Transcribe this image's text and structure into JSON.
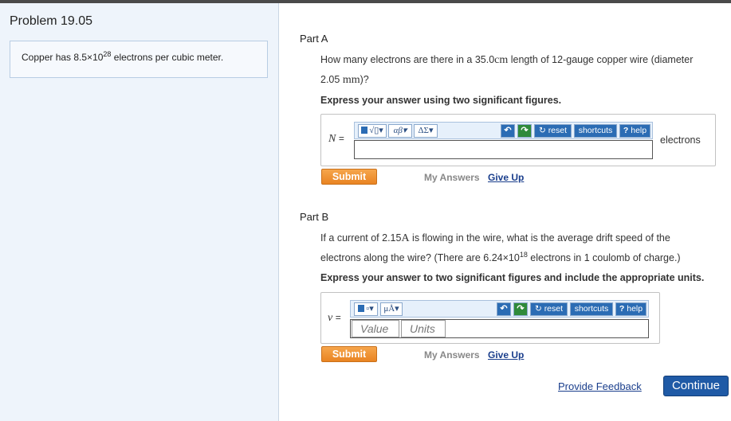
{
  "problem": {
    "title": "Problem 19.05",
    "statement_prefix": "Copper has 8.5×10",
    "statement_exp": "28",
    "statement_suffix": " electrons per cubic meter."
  },
  "partA": {
    "title": "Part A",
    "question_1": "How many electrons are there in a 35.0",
    "question_unit1": "cm",
    "question_2": " length of 12-gauge copper wire (diameter",
    "question_3": "2.05 ",
    "question_unit2": "mm",
    "question_4": ")?",
    "instruction": "Express your answer using two significant figures.",
    "variable": "N",
    "equals": "=",
    "unit_label": "electrons",
    "submit": "Submit",
    "my_answers": "My Answers",
    "give_up": "Give Up"
  },
  "partB": {
    "title": "Part B",
    "question_1": "If a current of 2.15",
    "question_unit1": "A",
    "question_2": " is flowing in the wire, what is the average drift speed of the",
    "question_3": "electrons along the wire? (There are 6.24×10",
    "question_exp": "18",
    "question_4": " electrons in 1 coulomb of charge.)",
    "instruction": "Express your answer to two significant figures and include the appropriate units.",
    "variable": "v",
    "equals": "=",
    "value_placeholder": "Value",
    "units_placeholder": "Units",
    "submit": "Submit",
    "my_answers": "My Answers",
    "give_up": "Give Up"
  },
  "toolbar": {
    "templates": "√▯",
    "greek": "αβ",
    "delta": "ΔΣ",
    "units_templates": "▫",
    "units_symbols": "μÅ",
    "undo": "↶",
    "redo": "↷",
    "reset": "reset",
    "shortcuts": "shortcuts",
    "help_mark": "?",
    "help": "help",
    "dropdown": "▾"
  },
  "footer": {
    "feedback": "Provide Feedback",
    "continue": "Continue"
  },
  "colors": {
    "sidebar_bg": "#eef4fb",
    "submit": "#e98422",
    "continue": "#1f5aa6",
    "link": "#1a3e8c"
  }
}
